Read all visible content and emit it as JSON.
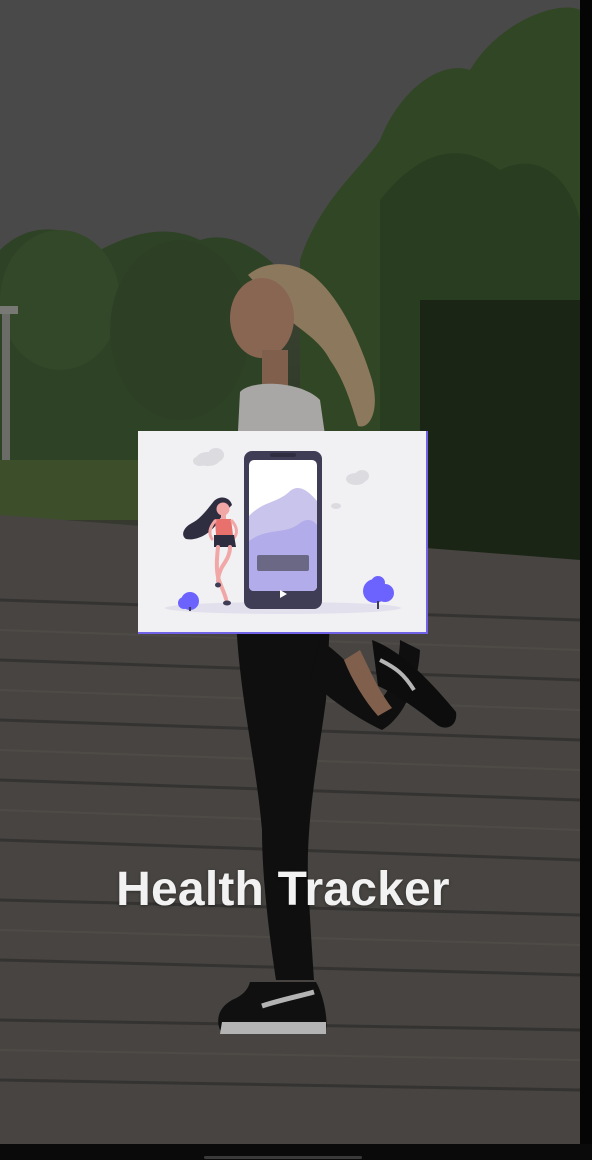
{
  "splash": {
    "title": "Health Tracker"
  },
  "colors": {
    "accent": "#6c63ff",
    "card_background": "#f1f0f3",
    "title_text": "#f2f2f2"
  },
  "icons": {
    "illustration": "runner-with-phone-illustration",
    "play": "play-icon"
  }
}
